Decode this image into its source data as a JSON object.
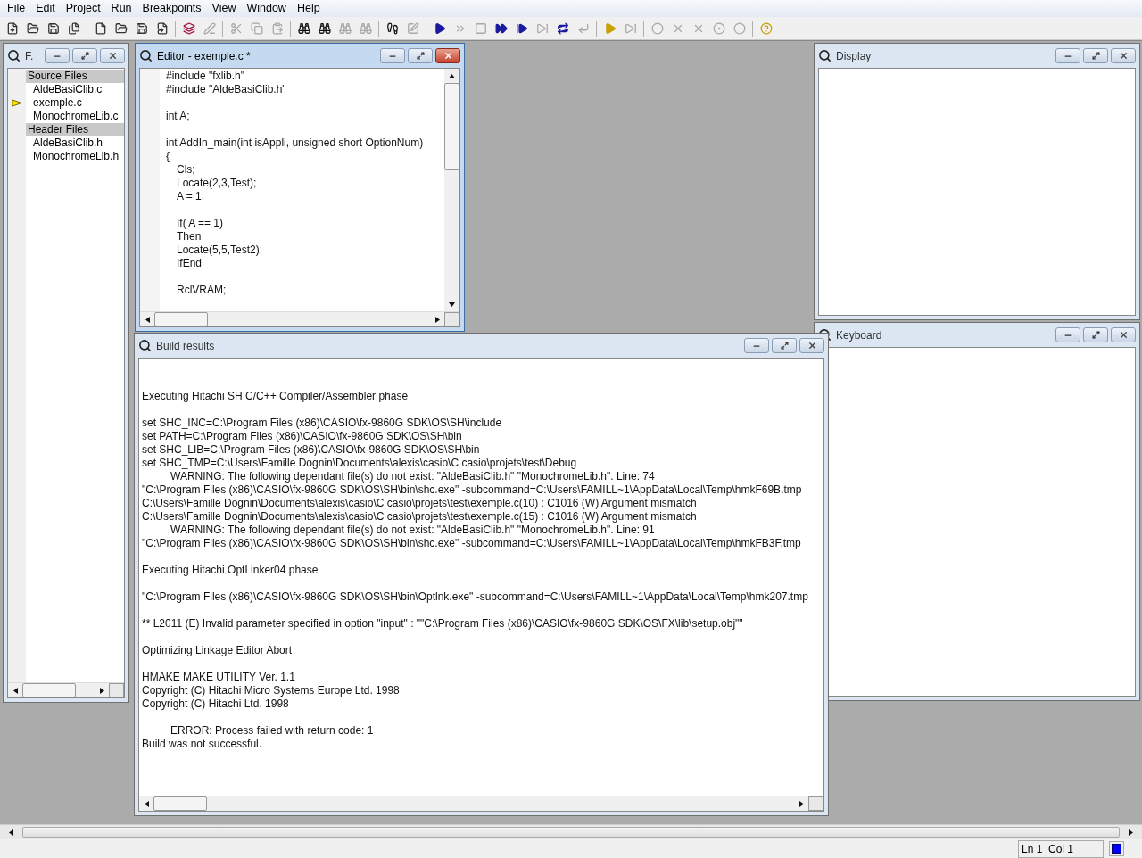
{
  "menu": [
    "File",
    "Edit",
    "Project",
    "Run",
    "Breakpoints",
    "View",
    "Window",
    "Help"
  ],
  "toolbar": [
    [
      {
        "disabled": false
      },
      {
        "disabled": false
      },
      {
        "disabled": false
      },
      {
        "disabled": false
      }
    ],
    [
      {
        "disabled": false
      },
      {
        "disabled": false
      },
      {
        "disabled": false
      },
      {
        "disabled": false
      }
    ],
    [
      {
        "disabled": false
      },
      {
        "disabled": true
      }
    ],
    [
      {
        "disabled": true
      },
      {
        "disabled": true
      },
      {
        "disabled": true
      }
    ],
    [
      {
        "disabled": false
      },
      {
        "disabled": false
      },
      {
        "disabled": true
      },
      {
        "disabled": true
      }
    ],
    [
      {
        "disabled": false
      },
      {
        "disabled": true
      }
    ],
    [
      {
        "disabled": false
      },
      {
        "disabled": true
      },
      {
        "disabled": true
      },
      {
        "disabled": false
      },
      {
        "disabled": false
      },
      {
        "disabled": true
      },
      {
        "disabled": false
      },
      {
        "disabled": true
      }
    ],
    [
      {
        "disabled": false
      },
      {
        "disabled": true
      }
    ],
    [
      {
        "disabled": true
      },
      {
        "disabled": true
      },
      {
        "disabled": true
      },
      {
        "disabled": true
      },
      {
        "disabled": true
      }
    ],
    [
      {
        "disabled": false
      }
    ]
  ],
  "files_window": {
    "title": "F.",
    "active": false,
    "groups": [
      {
        "label": "Source Files",
        "children": [
          {
            "label": "AldeBasiClib.c",
            "current": false
          },
          {
            "label": "exemple.c",
            "current": true
          },
          {
            "label": "MonochromeLib.c",
            "current": false
          }
        ]
      },
      {
        "label": "Header Files",
        "children": [
          {
            "label": "AldeBasiClib.h",
            "current": false
          },
          {
            "label": "MonochromeLib.h",
            "current": false
          }
        ]
      }
    ]
  },
  "editor_window": {
    "title": "Editor - exemple.c *",
    "active": true,
    "blocks": [
      {
        "lines": [
          {
            "text": "#include \"fxlib.h\"",
            "indented": false
          },
          {
            "text": "#include \"AldeBasiClib.h\"",
            "indented": false
          }
        ]
      },
      {
        "lines": [
          {
            "text": "int A;",
            "indented": false
          }
        ]
      },
      {
        "lines": [
          {
            "text": "int AddIn_main(int isAppli, unsigned short OptionNum)",
            "indented": false
          },
          {
            "text": "{",
            "indented": false
          },
          {
            "text": "Cls;",
            "indented": true
          },
          {
            "text": "Locate(2,3,Test);",
            "indented": true
          },
          {
            "text": "A = 1;",
            "indented": true
          }
        ]
      },
      {
        "lines": [
          {
            "text": "If( A == 1)",
            "indented": true
          },
          {
            "text": "Then",
            "indented": true
          },
          {
            "text": "Locate(5,5,Test2);",
            "indented": true
          },
          {
            "text": "IfEnd",
            "indented": true
          }
        ]
      },
      {
        "lines": [
          {
            "text": "RclVRAM;",
            "indented": true
          }
        ]
      }
    ]
  },
  "display_window": {
    "title": "Display",
    "active": false
  },
  "keyboard_window": {
    "title": "Keyboard",
    "active": false
  },
  "build_window": {
    "title": "Build results",
    "active": false,
    "blocks": [
      {
        "lines": [
          {
            "text": "Executing Hitachi SH C/C++ Compiler/Assembler phase",
            "indented": false
          }
        ]
      },
      {
        "lines": [
          {
            "text": "set SHC_INC=C:\\Program Files (x86)\\CASIO\\fx-9860G SDK\\OS\\SH\\include",
            "indented": false
          },
          {
            "text": "set PATH=C:\\Program Files (x86)\\CASIO\\fx-9860G SDK\\OS\\SH\\bin",
            "indented": false
          },
          {
            "text": "set SHC_LIB=C:\\Program Files (x86)\\CASIO\\fx-9860G SDK\\OS\\SH\\bin",
            "indented": false
          },
          {
            "text": "set SHC_TMP=C:\\Users\\Famille Dognin\\Documents\\alexis\\casio\\C casio\\projets\\test\\Debug",
            "indented": false
          },
          {
            "text": "WARNING: The following dependant file(s) do not exist: \"AldeBasiClib.h\" \"MonochromeLib.h\". Line: 74",
            "indented": true
          },
          {
            "text": "\"C:\\Program Files (x86)\\CASIO\\fx-9860G SDK\\OS\\SH\\bin\\shc.exe\" -subcommand=C:\\Users\\FAMILL~1\\AppData\\Local\\Temp\\hmkF69B.tmp",
            "indented": false
          },
          {
            "text": "C:\\Users\\Famille Dognin\\Documents\\alexis\\casio\\C casio\\projets\\test\\exemple.c(10) : C1016 (W) Argument mismatch",
            "indented": false
          },
          {
            "text": "C:\\Users\\Famille Dognin\\Documents\\alexis\\casio\\C casio\\projets\\test\\exemple.c(15) : C1016 (W) Argument mismatch",
            "indented": false
          },
          {
            "text": "WARNING: The following dependant file(s) do not exist: \"AldeBasiClib.h\" \"MonochromeLib.h\". Line: 91",
            "indented": true
          },
          {
            "text": "\"C:\\Program Files (x86)\\CASIO\\fx-9860G SDK\\OS\\SH\\bin\\shc.exe\" -subcommand=C:\\Users\\FAMILL~1\\AppData\\Local\\Temp\\hmkFB3F.tmp",
            "indented": false
          }
        ]
      },
      {
        "lines": [
          {
            "text": "Executing Hitachi OptLinker04 phase",
            "indented": false
          }
        ]
      },
      {
        "lines": [
          {
            "text": "\"C:\\Program Files (x86)\\CASIO\\fx-9860G SDK\\OS\\SH\\bin\\Optlnk.exe\" -subcommand=C:\\Users\\FAMILL~1\\AppData\\Local\\Temp\\hmk207.tmp",
            "indented": false
          }
        ]
      },
      {
        "lines": [
          {
            "text": "** L2011 (E) Invalid parameter specified in option \"input\" : \"\"C:\\Program Files (x86)\\CASIO\\fx-9860G SDK\\OS\\FX\\lib\\setup.obj\"\"",
            "indented": false
          }
        ]
      },
      {
        "lines": [
          {
            "text": "Optimizing Linkage Editor Abort",
            "indented": false
          }
        ]
      },
      {
        "lines": [
          {
            "text": "HMAKE MAKE UTILITY Ver. 1.1",
            "indented": false
          },
          {
            "text": "Copyright (C) Hitachi Micro Systems Europe Ltd. 1998",
            "indented": false
          },
          {
            "text": "Copyright (C) Hitachi Ltd. 1998",
            "indented": false
          }
        ]
      },
      {
        "lines": [
          {
            "text": "ERROR: Process failed with return code: 1",
            "indented": true
          },
          {
            "text": "Build was not successful.",
            "indented": false
          }
        ]
      }
    ]
  },
  "status_bar": {
    "position": "Ln 1  Col 1"
  }
}
